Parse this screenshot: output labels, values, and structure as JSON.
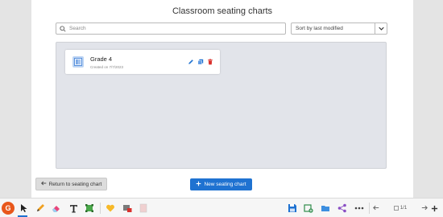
{
  "page": {
    "title": "Classroom seating charts"
  },
  "search": {
    "placeholder": "Search",
    "value": ""
  },
  "sort": {
    "selected": "Sort by last modified"
  },
  "cards": [
    {
      "name": "Grade 4",
      "created": "Created on 7/7/2023"
    }
  ],
  "buttons": {
    "return_label": "Return to seating chart",
    "new_label": "New seating chart"
  },
  "toolbar": {
    "logo_letter": "G",
    "page_indicator": "1/1"
  },
  "colors": {
    "accent": "#1f72d1",
    "logo": "#e8571b",
    "delete": "#d9302c",
    "edit": "#1f72d1"
  },
  "icons": [
    "search-icon",
    "chevron-down-icon",
    "seating-chart-icon",
    "edit-icon",
    "copy-icon",
    "delete-icon",
    "arrow-left-icon",
    "plus-icon",
    "cursor-icon",
    "pen-icon",
    "eraser-icon",
    "text-icon",
    "select-icon",
    "sticker-icon",
    "media-icon",
    "background-icon",
    "save-icon",
    "add-page-icon",
    "folder-icon",
    "share-icon",
    "more-icon",
    "prev-page-icon",
    "page-icon",
    "next-page-icon",
    "zoom-in-icon"
  ]
}
